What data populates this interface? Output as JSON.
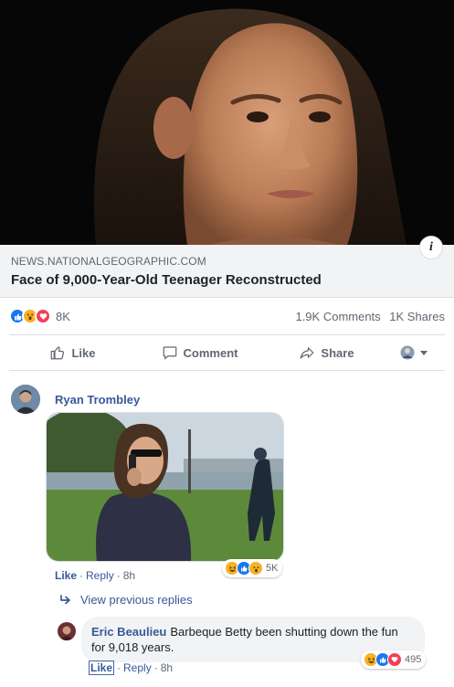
{
  "link_preview": {
    "domain": "NEWS.NATIONALGEOGRAPHIC.COM",
    "title": "Face of 9,000-Year-Old Teenager Reconstructed",
    "info_icon": "info-icon"
  },
  "post_stats": {
    "reactions": [
      "like-icon",
      "wow-icon",
      "love-icon"
    ],
    "reaction_count": "8K",
    "comments": "1.9K Comments",
    "shares": "1K Shares"
  },
  "actions": {
    "like": "Like",
    "comment": "Comment",
    "share": "Share",
    "audience_icon": "audience-avatar-icon"
  },
  "comment1": {
    "author": "Ryan Trombley",
    "like_label": "Like",
    "reply_label": "Reply",
    "time": "8h",
    "reactions": [
      "haha-icon",
      "like-icon",
      "wow-icon"
    ],
    "reaction_count": "5K"
  },
  "replies": {
    "view_previous": "View previous replies"
  },
  "comment2": {
    "author": "Eric Beaulieu",
    "text": "Barbeque Betty been shutting down the fun for 9,018 years.",
    "like_label": "Like",
    "reply_label": "Reply",
    "time": "8h",
    "reactions": [
      "haha-icon",
      "like-icon",
      "love-icon"
    ],
    "reaction_count": "495"
  },
  "colors": {
    "link_blue": "#385898",
    "fb_blue": "#1877f2",
    "meta_gray": "#606770",
    "panel_gray": "#f2f3f5"
  }
}
